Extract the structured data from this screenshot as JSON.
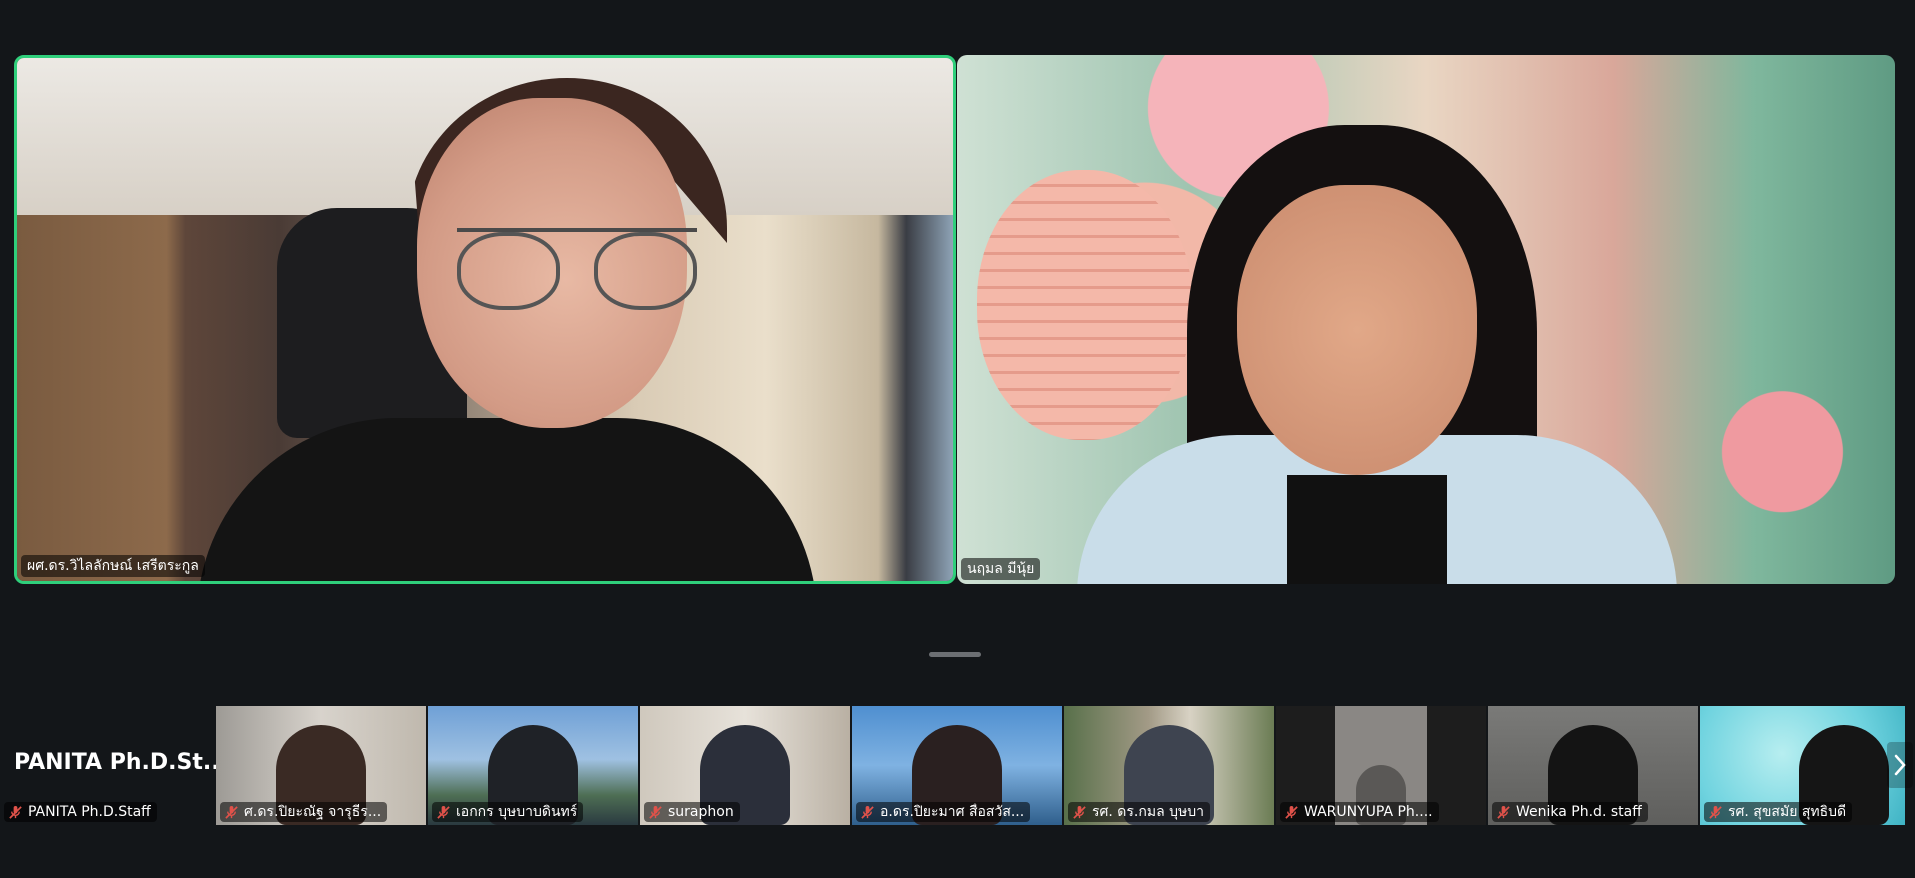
{
  "main_tiles": [
    {
      "name": "ผศ.ดร.วิไลลักษณ์  เสรีตระกูล",
      "active_speaker": true
    },
    {
      "name": "นฤมล  มีนุ้ย",
      "active_speaker": false
    }
  ],
  "self_view": {
    "display_name": "PANITA  Ph.D.St...",
    "label": "PANITA Ph.D.Staff",
    "muted": true
  },
  "gallery": [
    {
      "name": "ศ.ดร.ปิยะณัฐ  จารุธีร...",
      "muted": true
    },
    {
      "name": "เอกกร บุษบาบดินทร์",
      "muted": true
    },
    {
      "name": "suraphon",
      "muted": true
    },
    {
      "name": "อ.ดร.ปิยะมาศ  สื่อสวัส...",
      "muted": true
    },
    {
      "name": "รศ. ดร.กมล บุษบา",
      "muted": true
    },
    {
      "name": "WARUNYUPA Ph....",
      "muted": true
    },
    {
      "name": "Wenika Ph.d. staff",
      "muted": true
    },
    {
      "name": "รศ. สุขสมัย สุทธิบดี",
      "muted": true
    }
  ],
  "colors": {
    "active_speaker_border": "#2fcf7b",
    "muted_icon": "#e0524a",
    "background": "#131619"
  },
  "icons": {
    "mute": "microphone-off-icon",
    "next": "chevron-right-icon"
  }
}
